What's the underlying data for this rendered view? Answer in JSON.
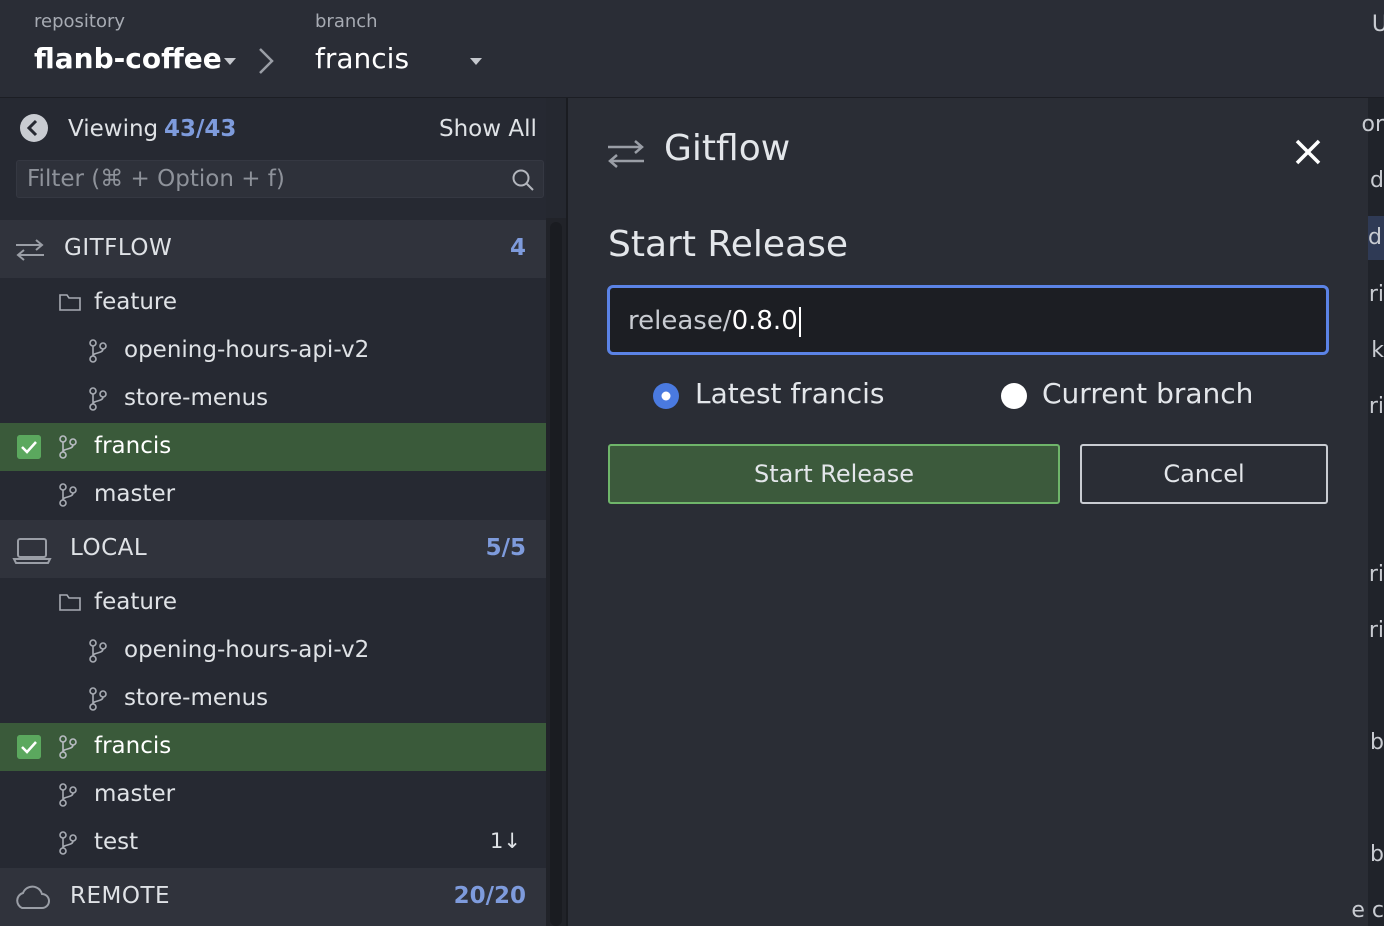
{
  "topbar": {
    "repository_label": "repository",
    "repository_name": "flanb-coffee",
    "branch_label": "branch",
    "branch_name": "francis",
    "right_edge_letter": "U"
  },
  "sidebar": {
    "viewing_label": "Viewing",
    "viewing_count": "43/43",
    "show_all": "Show All",
    "filter_placeholder": "Filter (⌘ + Option + f)",
    "sections": {
      "gitflow": {
        "title": "GITFLOW",
        "count": "4",
        "items": [
          "feature",
          "opening-hours-api-v2",
          "store-menus",
          "francis",
          "master"
        ]
      },
      "local": {
        "title": "LOCAL",
        "count": "5/5",
        "items": [
          "feature",
          "opening-hours-api-v2",
          "store-menus",
          "francis",
          "master",
          "test"
        ],
        "test_badge": "1↓"
      },
      "remote": {
        "title": "REMOTE",
        "count": "20/20"
      }
    }
  },
  "dialog": {
    "title": "Gitflow",
    "subtitle": "Start Release",
    "input_prefix": "release/",
    "input_value": "0.8.0",
    "radio_options": [
      {
        "label": "Latest francis",
        "selected": true
      },
      {
        "label": "Current branch",
        "selected": false
      }
    ],
    "primary_button": "Start Release",
    "cancel_button": "Cancel"
  },
  "edge_letters": [
    "or",
    "d",
    "d",
    "ri",
    "k",
    "ri",
    "ri",
    "ri",
    "b",
    "b",
    "e c"
  ],
  "colors": {
    "accent_blue": "#5b83e6",
    "selected_row": "#3a5a3a",
    "check_green": "#5ba85e",
    "count_blue": "#7e9bdc",
    "primary_button": "#3c5a3c"
  }
}
